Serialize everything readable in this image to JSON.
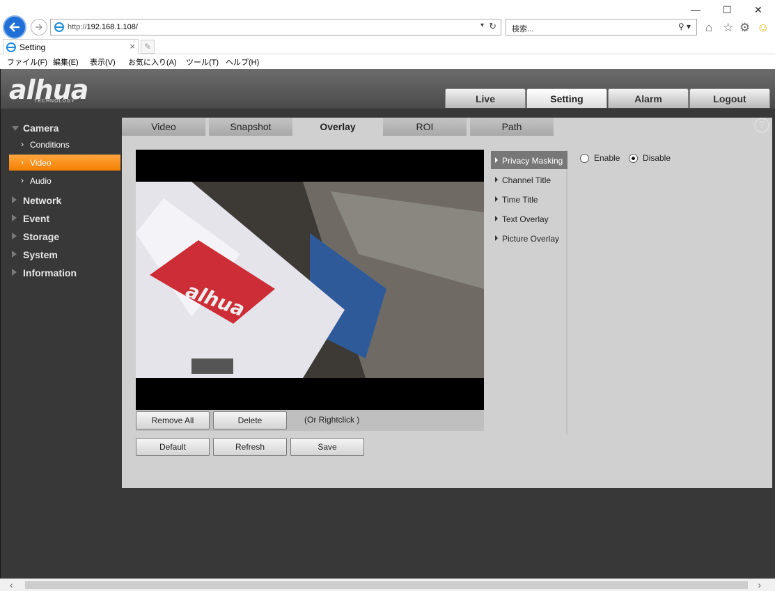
{
  "browser": {
    "url_prefix": "http://",
    "url_host": "192.168.1.108/",
    "search_placeholder": "検索...",
    "tab_title": "Setting",
    "menu": [
      "ファイル(F)",
      "編集(E)",
      "表示(V)",
      "お気に入り(A)",
      "ツール(T)",
      "ヘルプ(H)"
    ]
  },
  "app": {
    "logo": "alhua",
    "logo_sub": "TECHNOLOGY",
    "topnav": [
      "Live",
      "Setting",
      "Alarm",
      "Logout"
    ],
    "sidebar": {
      "camera": "Camera",
      "camera_items": [
        "Conditions",
        "Video",
        "Audio"
      ],
      "items": [
        "Network",
        "Event",
        "Storage",
        "System",
        "Information"
      ]
    },
    "tabs": [
      "Video",
      "Snapshot",
      "Overlay",
      "ROI",
      "Path"
    ],
    "help_glyph": "?",
    "video_buttons": {
      "remove_all": "Remove All",
      "delete": "Delete",
      "hint": "(Or Rightclick )"
    },
    "bottom_buttons": {
      "default": "Default",
      "refresh": "Refresh",
      "save": "Save"
    },
    "overlay_menu": [
      "Privacy Masking",
      "Channel Title",
      "Time Title",
      "Text Overlay",
      "Picture Overlay"
    ],
    "privacy": {
      "enable": "Enable",
      "disable": "Disable",
      "selected": "Disable"
    }
  },
  "colors": {
    "accent_orange": "#f57f00",
    "sidebar_bg": "#383838",
    "content_bg": "#d0d0d0"
  }
}
